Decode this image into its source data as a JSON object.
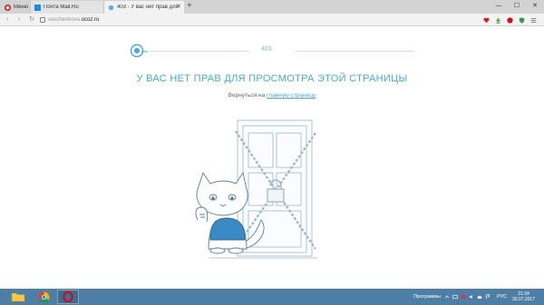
{
  "browser": {
    "tabs": [
      {
        "label": "Меню"
      },
      {
        "label": "Почта Mail.Ru"
      },
      {
        "label": "403 - У вас нет прав для"
      }
    ],
    "new_tab_label": "+",
    "address": {
      "host": "savchenkova.",
      "domain": "ucoz.ru"
    }
  },
  "page": {
    "error_code": "403",
    "error_title": "У ВАС НЕТ ПРАВ ДЛЯ ПРОСМОТРА ЭТОЙ СТРАНИЦЫ",
    "back_text": "Вернуться на",
    "back_link": "главную страницу"
  },
  "taskbar": {
    "programs_label": "Программы",
    "language": "РУС",
    "time": "21:34",
    "date": "30.07.2017"
  },
  "colors": {
    "accent": "#4aa8d6",
    "taskbar": "#4d7fa6",
    "opera_red": "#cc0f16"
  }
}
